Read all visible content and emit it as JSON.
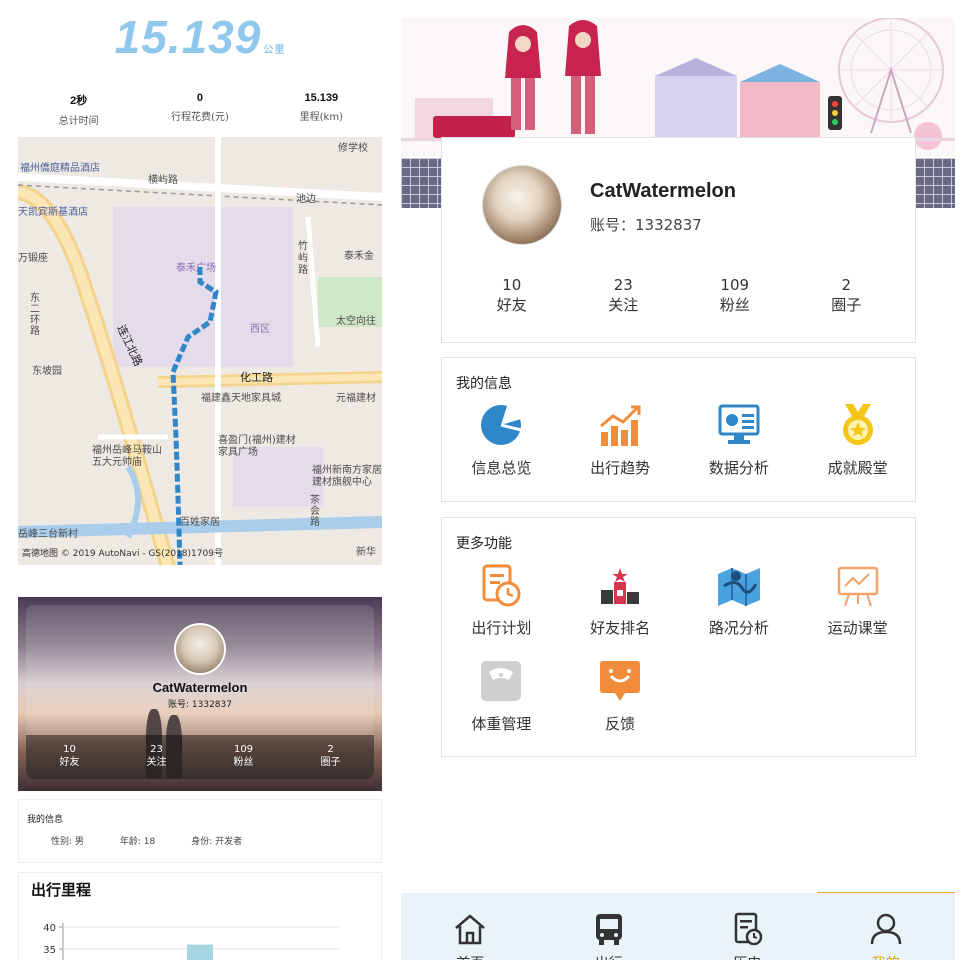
{
  "left": {
    "trip": {
      "distance": "15.139",
      "distance_unit": "公里",
      "stats": [
        {
          "value": "2秒",
          "label": "总计时间"
        },
        {
          "value": "0",
          "label": "行程花费(元)"
        },
        {
          "value": "15.139",
          "label": "里程(km)"
        }
      ]
    },
    "map": {
      "labels": [
        "福州僑庭精品酒店",
        "横屿路",
        "修学校",
        "池边",
        "天凯宾斯基酒店",
        "竹屿路",
        "泰禾金",
        "万锻座",
        "泰禾广场",
        "东二环路",
        "西区",
        "太空向往",
        "连江北路",
        "东坡园",
        "化工路",
        "元福建材",
        "福建鑫天地家具城",
        "福州岳峰马鞍山五大元帅庙",
        "喜盈门(福州)建材家具广场",
        "福州新南方家居建材旗舰中心",
        "茶会路",
        "百姓家居",
        "岳峰三台新村",
        "新华"
      ],
      "credit": "高德地图 © 2019 AutoNavi - GS(2018)1709号"
    },
    "profile": {
      "name": "CatWatermelon",
      "account": "账号: 1332837",
      "stats": [
        {
          "value": "10",
          "label": "好友"
        },
        {
          "value": "23",
          "label": "关注"
        },
        {
          "value": "109",
          "label": "粉丝"
        },
        {
          "value": "2",
          "label": "圈子"
        }
      ]
    },
    "info": {
      "title": "我的信息",
      "gender": "性别: 男",
      "age": "年龄: 18",
      "role": "身份: 开发者"
    },
    "mileage": {
      "title": "出行里程",
      "y_ticks": [
        "40",
        "35"
      ]
    }
  },
  "chart_data": {
    "type": "bar",
    "title": "出行里程",
    "ylim": [
      30,
      40
    ],
    "yticks": [
      35,
      40
    ],
    "categories": [
      ""
    ],
    "values": [
      36
    ],
    "xlabel": "",
    "ylabel": ""
  },
  "right": {
    "profile": {
      "name": "CatWatermelon",
      "account": "账号：1332837",
      "stats": [
        {
          "value": "10",
          "label": "好友"
        },
        {
          "value": "23",
          "label": "关注"
        },
        {
          "value": "109",
          "label": "粉丝"
        },
        {
          "value": "2",
          "label": "圈子"
        }
      ]
    },
    "my_info": {
      "title": "我的信息",
      "items": [
        {
          "label": "信息总览",
          "icon": "pie-chart-icon"
        },
        {
          "label": "出行趋势",
          "icon": "trend-chart-icon"
        },
        {
          "label": "数据分析",
          "icon": "monitor-chart-icon"
        },
        {
          "label": "成就殿堂",
          "icon": "medal-icon"
        }
      ]
    },
    "more": {
      "title": "更多功能",
      "items": [
        {
          "label": "出行计划",
          "icon": "plan-clock-icon"
        },
        {
          "label": "好友排名",
          "icon": "podium-icon"
        },
        {
          "label": "路况分析",
          "icon": "map-icon"
        },
        {
          "label": "运动课堂",
          "icon": "board-icon"
        },
        {
          "label": "体重管理",
          "icon": "scale-icon"
        },
        {
          "label": "反馈",
          "icon": "feedback-icon"
        }
      ]
    },
    "tabs": [
      {
        "label": "首页",
        "icon": "home-icon"
      },
      {
        "label": "出行",
        "icon": "bus-icon"
      },
      {
        "label": "历史",
        "icon": "history-icon"
      },
      {
        "label": "我的",
        "icon": "user-icon",
        "active": true
      }
    ],
    "colors": {
      "accent": "#e7a31e",
      "blue": "#2f86c8",
      "orange": "#f08c3a"
    }
  }
}
